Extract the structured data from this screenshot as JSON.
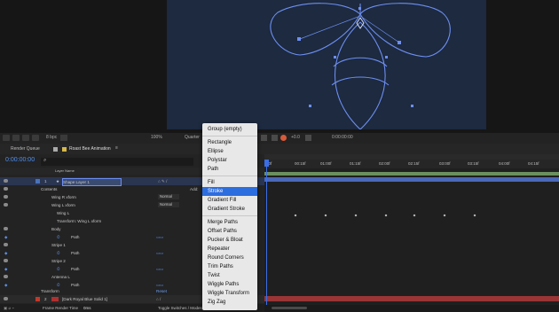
{
  "viewer_toolbar": {
    "bpc_label": "8 bpc",
    "zoom_value": "100%",
    "resolution_value": "Quarter",
    "exposure_value": "+0.0",
    "timecode_value": "0:00:00:00"
  },
  "panel_tabs": {
    "render_queue_label": "Render Queue",
    "comp_tab_label": "Roast Bee Animation"
  },
  "timeline": {
    "current_time": "0:00:00:00",
    "column_header_layer_name": "Layer Name",
    "layers": [
      {
        "num": "1",
        "name": "Shape Layer 1"
      },
      {
        "num": "2",
        "name": "[Dark Royal Blue Solid 1]"
      }
    ],
    "tree": [
      "Contents",
      "Wing R xform",
      "Wing L xform",
      "Wing L",
      "Transform: Wing L xform",
      "Body",
      "Path",
      "Stripe 1",
      "Path",
      "Stripe 2",
      "Path",
      "Antenna L",
      "Path",
      "Antenna R",
      "Path",
      "Transform"
    ],
    "mode_normal": "Normal",
    "add_label": "Add:",
    "reset_label": "Reset",
    "footer_left": "Frame Render Time",
    "footer_left_value": "0ms",
    "footer_right": "Toggle Switches / Modes"
  },
  "ruler": {
    "ticks": [
      "00f",
      "00:15f",
      "01:00f",
      "01:15f",
      "02:00f",
      "02:15f",
      "03:00f",
      "03:15f",
      "04:00f",
      "04:15f"
    ]
  },
  "context_menu": {
    "items": [
      "Group (empty)",
      "Rectangle",
      "Ellipse",
      "Polystar",
      "Path",
      "Fill",
      "Stroke",
      "Gradient Fill",
      "Gradient Stroke",
      "Merge Paths",
      "Offset Paths",
      "Pucker & Bloat",
      "Repeater",
      "Round Corners",
      "Trim Paths",
      "Twist",
      "Wiggle Paths",
      "Wiggle Transform",
      "Zig Zag"
    ],
    "selected_index": 6
  },
  "colors": {
    "accent_blue": "#2c6de0",
    "canvas_bg": "#1d2a3f",
    "path_color": "#6d8ef2",
    "highlight_orange": "#f08a3c",
    "layer_label_red": "#c0392b",
    "work_area_green": "#6b8f5e"
  }
}
